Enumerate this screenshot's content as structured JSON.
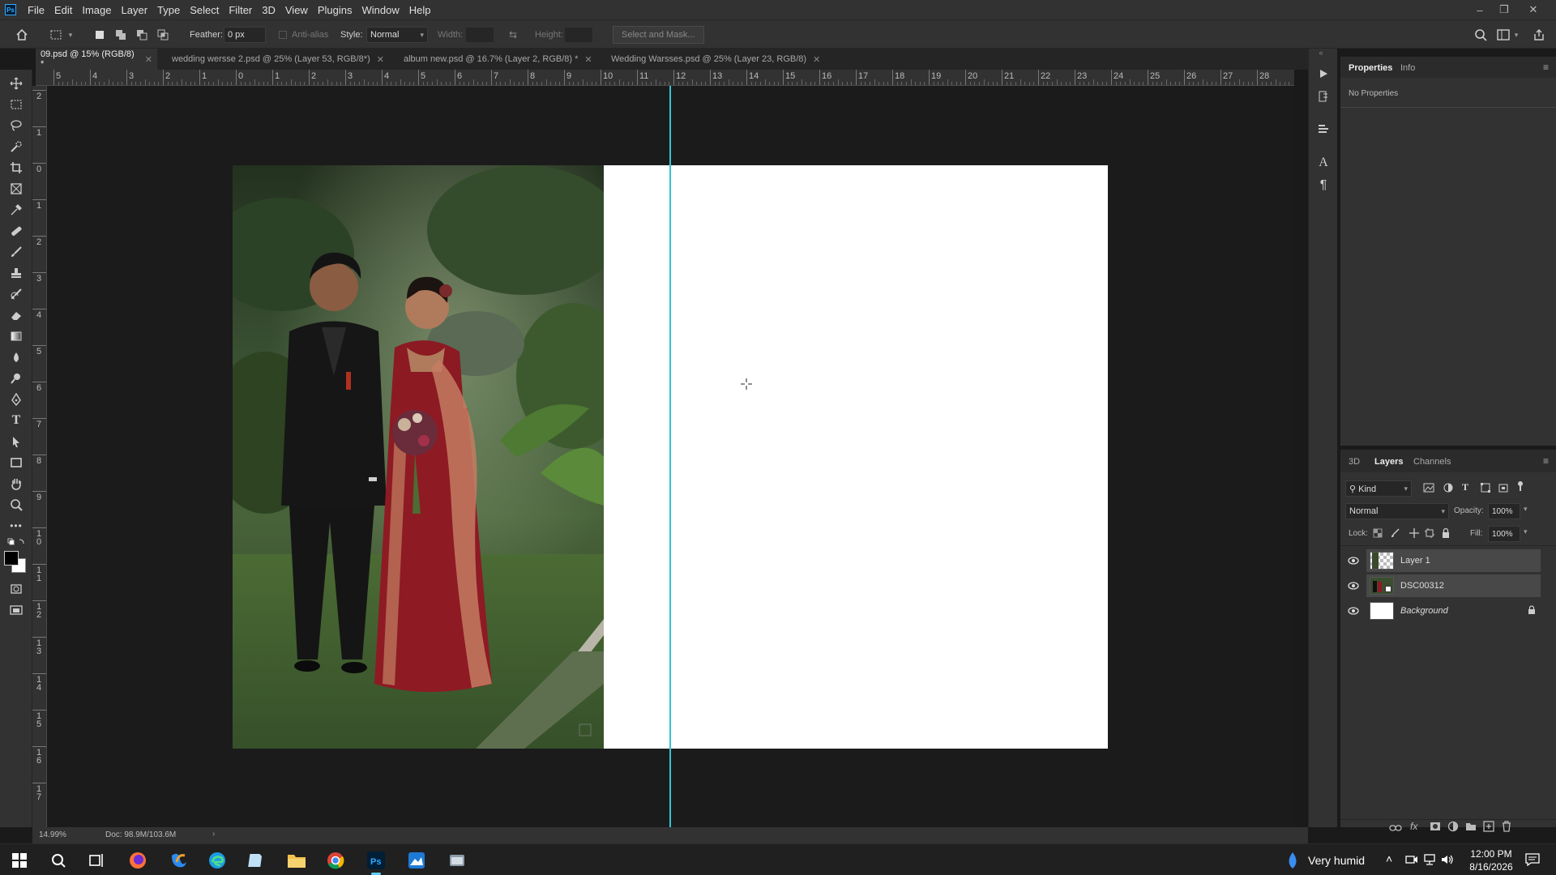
{
  "app": {
    "logo": "Ps"
  },
  "menu": [
    "File",
    "Edit",
    "Image",
    "Layer",
    "Type",
    "Select",
    "Filter",
    "3D",
    "View",
    "Plugins",
    "Window",
    "Help"
  ],
  "options": {
    "feather_label": "Feather:",
    "feather_value": "0 px",
    "antialias_label": "Anti-alias",
    "style_label": "Style:",
    "style_value": "Normal",
    "width_label": "Width:",
    "height_label": "Height:",
    "select_mask_label": "Select and Mask..."
  },
  "tabs": [
    {
      "label": "09.psd @ 15% (RGB/8) *",
      "active": true
    },
    {
      "label": "wedding wersse 2.psd @ 25% (Layer 53, RGB/8*)",
      "active": false
    },
    {
      "label": "album new.psd @ 16.7% (Layer 2, RGB/8) *",
      "active": false
    },
    {
      "label": "Wedding Warsses.psd @ 25% (Layer 23, RGB/8)",
      "active": false
    }
  ],
  "ruler_top": [
    "5",
    "4",
    "3",
    "2",
    "1",
    "0",
    "1",
    "2",
    "3",
    "4",
    "5",
    "6",
    "7",
    "8",
    "9",
    "10",
    "11",
    "12",
    "13",
    "14",
    "15",
    "16",
    "17",
    "18",
    "19",
    "20",
    "21",
    "22",
    "23",
    "24",
    "25",
    "26",
    "27",
    "28"
  ],
  "ruler_left": [
    "2",
    "1",
    "0",
    "1",
    "2",
    "3",
    "4",
    "5",
    "6",
    "7",
    "8",
    "9",
    "10",
    "11",
    "12",
    "13",
    "14",
    "15",
    "16",
    "17"
  ],
  "properties": {
    "tab_properties": "Properties",
    "tab_info": "Info",
    "empty_text": "No Properties"
  },
  "layers_panel": {
    "tab_3d": "3D",
    "tab_layers": "Layers",
    "tab_channels": "Channels",
    "filter_kind": "Kind",
    "blend_mode": "Normal",
    "opacity_label": "Opacity:",
    "opacity_value": "100%",
    "lock_label": "Lock:",
    "fill_label": "Fill:",
    "fill_value": "100%",
    "layers": [
      {
        "name": "Layer 1",
        "selected": true
      },
      {
        "name": "DSC00312",
        "selected": true
      },
      {
        "name": "Background",
        "selected": false,
        "locked": true
      }
    ]
  },
  "status": {
    "zoom": "14.99%",
    "doc": "Doc: 98.9M/103.6M"
  },
  "taskbar": {
    "weather": "Very humid",
    "time": "12:00 PM",
    "date": "8/16/2026"
  },
  "colors": {
    "guide": "#35c4d9",
    "ps_blue": "#31a8ff",
    "panel_bg": "#323232",
    "workspace_bg": "#1b1b1b"
  }
}
